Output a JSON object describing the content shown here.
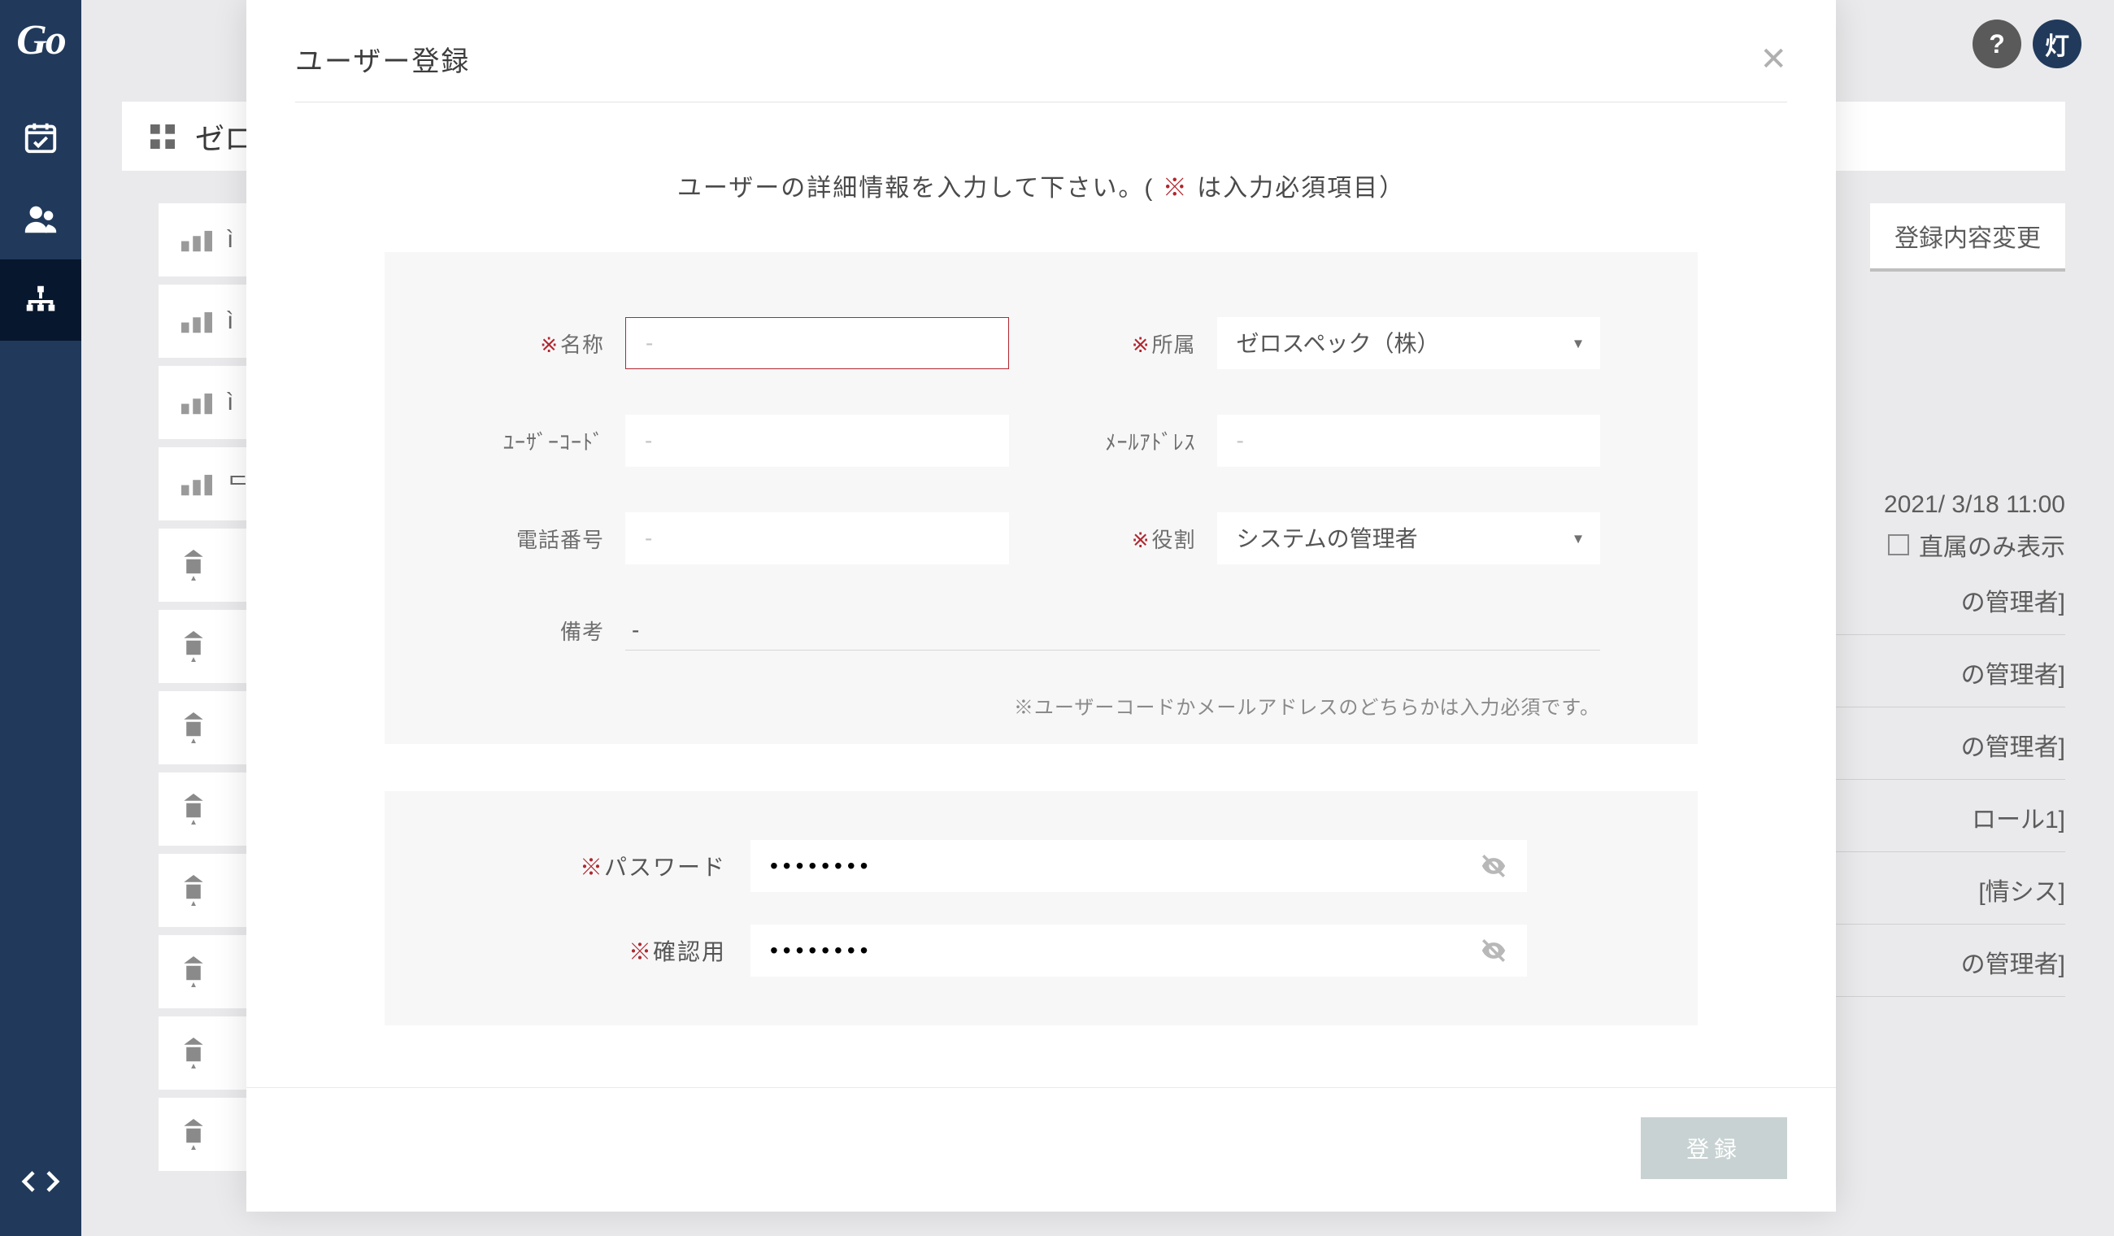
{
  "app": {
    "logo": "Go"
  },
  "header": {
    "help_label": "?",
    "brand_label": "灯"
  },
  "bg": {
    "page_title_prefix": "ゼロ",
    "tree_prefix_1": "ì",
    "tree_prefix_2": "ì",
    "tree_prefix_3": "ì",
    "tree_prefix_4": "ᄃ",
    "tab_change": "登録内容変更",
    "timestamp": "2021/ 3/18 11:00",
    "direct_only": "直属のみ表示",
    "roles": [
      "の管理者]",
      "の管理者]",
      "の管理者]",
      "ロール1]",
      "[情シス]",
      "の管理者]"
    ]
  },
  "modal": {
    "title": "ユーザー登録",
    "instruction_pre": "ユーザーの詳細情報を入力して下さい。( ",
    "instruction_req": "※",
    "instruction_post": " は入力必須項目）",
    "labels": {
      "name": "名称",
      "affiliation": "所属",
      "user_code": "ﾕｰｻﾞｰｺｰﾄﾞ",
      "email": "ﾒｰﾙｱﾄﾞﾚｽ",
      "phone": "電話番号",
      "role": "役割",
      "notes": "備考",
      "password": "パスワード",
      "confirm": "確認用"
    },
    "placeholders": {
      "dash": "-"
    },
    "values": {
      "affiliation": "ゼロスペック（株）",
      "role": "システムの管理者",
      "notes": "-"
    },
    "helper": "※ユーザーコードかメールアドレスのどちらかは入力必須です。",
    "submit": "登録"
  }
}
